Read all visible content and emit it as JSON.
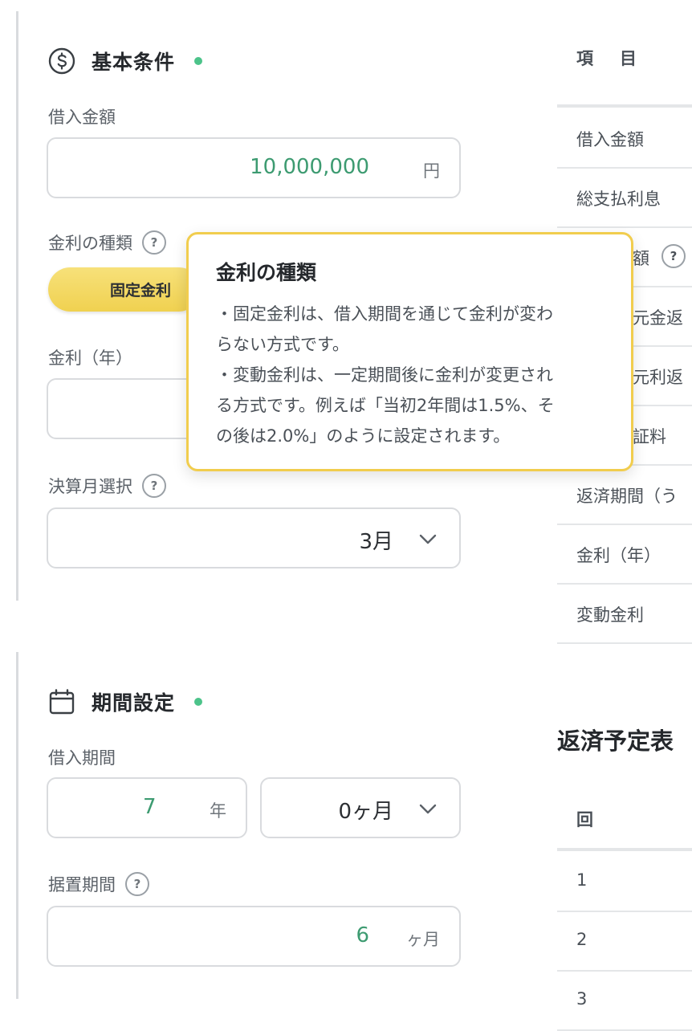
{
  "basic": {
    "title": "基本条件",
    "loan_amount_label": "借入金額",
    "loan_amount_value": "10,000,000",
    "loan_amount_unit": "円",
    "rate_type_label": "金利の種類",
    "rate_type_help": "?",
    "rate_type_selected": "固定金利",
    "rate_label": "金利（年）",
    "closing_month_label": "決算月選択",
    "closing_month_help": "?",
    "closing_month_value": "3月"
  },
  "tooltip": {
    "title": "金利の種類",
    "lines": [
      "・固定金利は、借入期間を通じて金利が変わ",
      "らない方式です。",
      "・変動金利は、一定期間後に金利が変更され",
      "る方式です。例えば「当初2年間は1.5%、そ",
      "の後は2.0%」のように設定されます。"
    ]
  },
  "period": {
    "title": "期間設定",
    "loan_period_label": "借入期間",
    "years_value": "7",
    "years_unit": "年",
    "months_value": "0ヶ月",
    "grace_label": "据置期間",
    "grace_help": "?",
    "grace_value": "6",
    "grace_unit": "ヶ月"
  },
  "summary": {
    "header": "項　目",
    "rows": [
      "借入金額",
      "総支払利息",
      "額",
      "元金返",
      "元利返",
      "証料",
      "返済期間（う",
      "金利（年）",
      "変動金利"
    ],
    "row3_help": "?"
  },
  "schedule": {
    "title": "返済予定表",
    "header": "回",
    "rows": [
      "1",
      "2",
      "3"
    ]
  },
  "colors": {
    "accent_green": "#3d9b71",
    "status_dot": "#4cc38a",
    "pill_yellow": "#f0d150",
    "tooltip_border": "#f1cd4e"
  }
}
